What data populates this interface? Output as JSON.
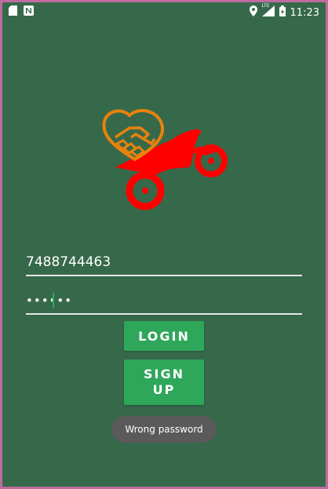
{
  "statusbar": {
    "time": "11:23",
    "network_label": "LTE",
    "icons": [
      "sd-card-icon",
      "notification-n-icon",
      "location-icon",
      "signal-icon",
      "battery-icon"
    ]
  },
  "login_form": {
    "phone_value": "7488744463",
    "password_value": "••••••"
  },
  "buttons": {
    "login_label": "LOGIN",
    "signup_line1": "SIGN",
    "signup_line2": "UP"
  },
  "toast": {
    "message": "Wrong password"
  },
  "colors": {
    "background": "#36694a",
    "button": "#2ea75a",
    "logo_heart": "#e8820c",
    "logo_bike": "#ff0000"
  }
}
